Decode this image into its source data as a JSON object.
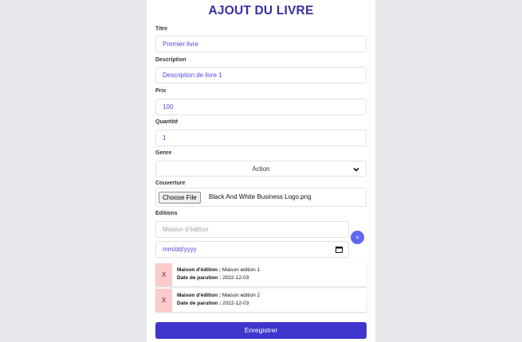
{
  "form": {
    "title": "AJOUT DU LIVRE",
    "titre": {
      "label": "Titre",
      "value": "Premier livre"
    },
    "description": {
      "label": "Description",
      "value": "Description de livre 1"
    },
    "prix": {
      "label": "Prix",
      "value": "100"
    },
    "quantite": {
      "label": "Quantité",
      "value": "1"
    },
    "genre": {
      "label": "Genre",
      "value": "Action"
    },
    "couverture": {
      "label": "Couverture",
      "button_label": "Choose File",
      "file_name": "Black And White Business Logo.png"
    },
    "editions": {
      "label": "Editions",
      "maison_placeholder": "Maison d'édition",
      "date_placeholder": "mm/dd/yyyy",
      "add_label": "+",
      "items": [
        {
          "remove_label": "X",
          "maison_key": "Maison d'édition :",
          "maison_value": "Maison edition 1",
          "date_key": "Date de parution :",
          "date_value": "2022-12-03"
        },
        {
          "remove_label": "X",
          "maison_key": "Maison d'édition :",
          "maison_value": "Maison edition 2",
          "date_key": "Date de parution :",
          "date_value": "2022-12-03"
        }
      ]
    },
    "submit_label": "Enregistrer"
  },
  "colors": {
    "accent": "#4f46e5",
    "title": "#3730a3",
    "submit": "#3f35cc",
    "remove": "#fecaca",
    "background": "#e5e7eb"
  }
}
